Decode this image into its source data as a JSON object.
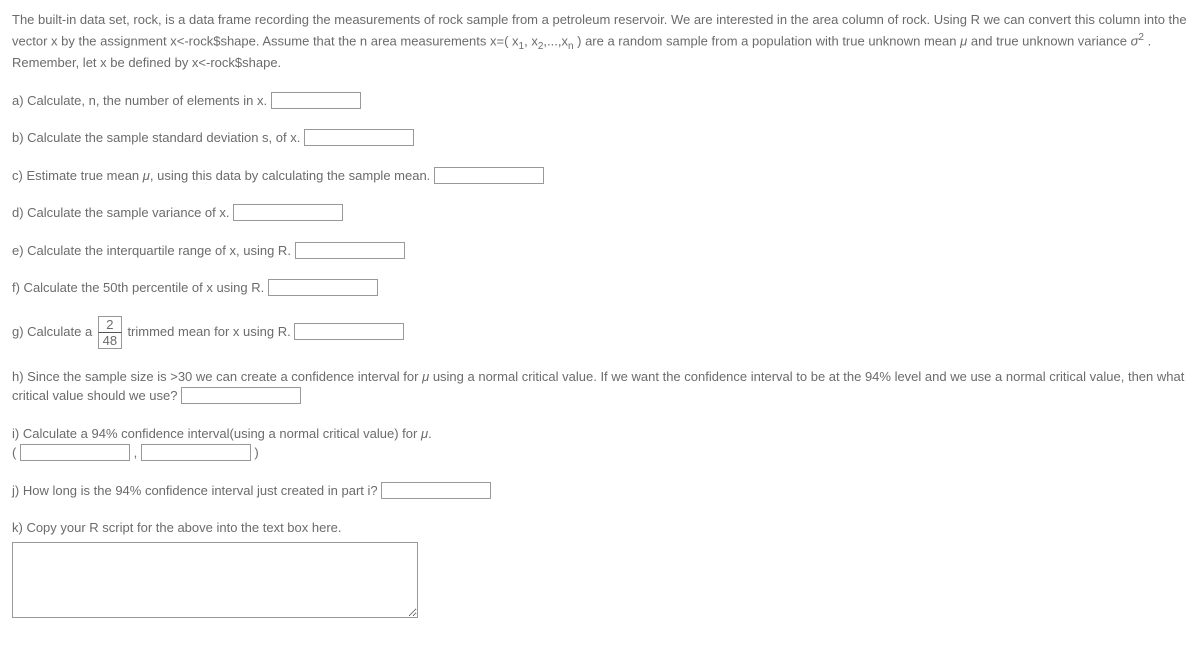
{
  "intro": "The built-in data set, rock, is a data frame recording the measurements of rock sample from a petroleum reservoir. We are interested in the area column of rock. Using R we can convert this column into the vector x by the assignment x<-rock$shape. Assume that the n area measurements x=( x₁, x₂,...,xₙ ) are a random sample from a population with true unknown mean μ and true unknown variance  σ² . Remember, let x be defined by x<-rock$shape.",
  "a_text": "a) Calculate, n, the number of elements in x. ",
  "b_text": "b) Calculate the sample standard deviation s, of x. ",
  "c_text": "c) Estimate true mean μ, using this data by calculating the sample mean. ",
  "d_text": "d) Calculate the sample variance of x. ",
  "e_text": "e) Calculate the interquartile range of x, using R. ",
  "f_text": "f) Calculate the 50th percentile of x using R. ",
  "g_pre": "g) Calculate a ",
  "g_num": "2",
  "g_den": "48",
  "g_post": " trimmed mean for x using R. ",
  "h_pre": "h) Since the sample size is >30 we can create a confidence interval for μ using a normal critical value. If we want the confidence interval to be at the 94% level and we use a normal critical value, then what critical value should we use? ",
  "i_pre": "i) Calculate a 94% confidence interval(using a normal critical value) for μ.",
  "i_open": "( ",
  "i_comma": " , ",
  "i_close": " )",
  "j_text": "j) How long is the 94% confidence interval just created in part i? ",
  "k_text": "k) Copy your R script for the above into the text box here."
}
